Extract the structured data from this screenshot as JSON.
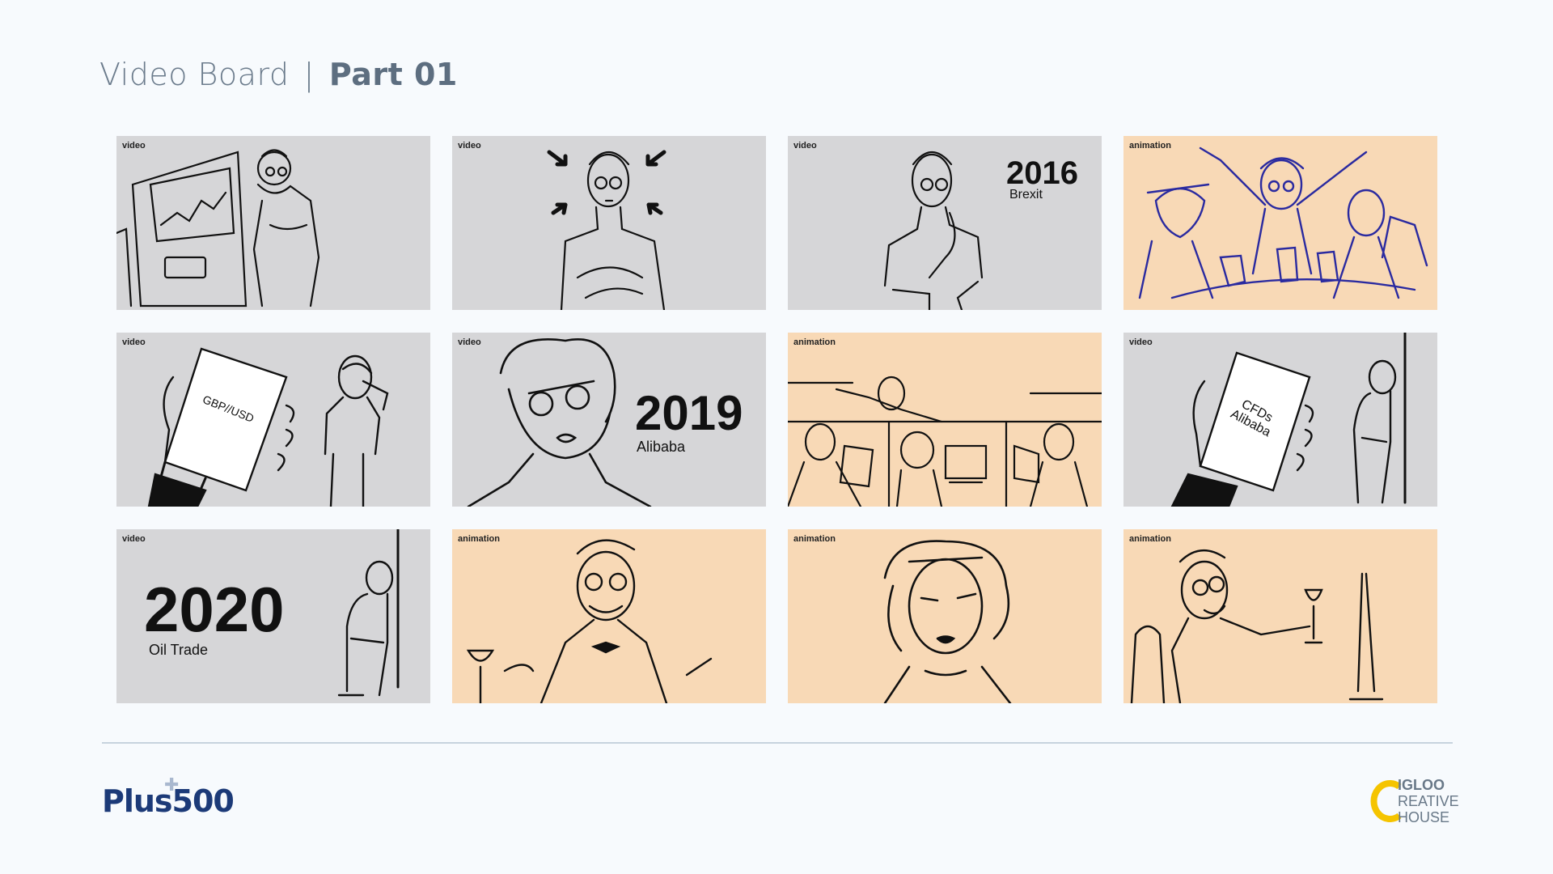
{
  "header": {
    "title": "Video Board",
    "separator": "|",
    "part": "Part 01"
  },
  "frames": [
    {
      "tag": "video",
      "type": "video"
    },
    {
      "tag": "video",
      "type": "video"
    },
    {
      "tag": "video",
      "type": "video",
      "big": "2016",
      "small": "Brexit"
    },
    {
      "tag": "animation",
      "type": "animation"
    },
    {
      "tag": "video",
      "type": "video",
      "screen": "GBP//USD"
    },
    {
      "tag": "video",
      "type": "video",
      "big": "2019",
      "small": "Alibaba"
    },
    {
      "tag": "animation",
      "type": "animation"
    },
    {
      "tag": "video",
      "type": "video",
      "screen_line1": "CFDs",
      "screen_line2": "Alibaba"
    },
    {
      "tag": "video",
      "type": "video",
      "big": "2020",
      "small": "Oil Trade"
    },
    {
      "tag": "animation",
      "type": "animation"
    },
    {
      "tag": "animation",
      "type": "animation"
    },
    {
      "tag": "animation",
      "type": "animation"
    }
  ],
  "footer": {
    "left_logo": "Plus500",
    "right_logo_line1": "IGLOO",
    "right_logo_line2": "REATIVE",
    "right_logo_line3": "HOUSE"
  },
  "colors": {
    "video_bg": "#d6d6d8",
    "animation_bg": "#f8d9b6",
    "sketch_ink": "#111111",
    "blue_sketch": "#2a2aa0",
    "brand_blue": "#1c3a78",
    "igloo_yellow": "#f5c400"
  }
}
